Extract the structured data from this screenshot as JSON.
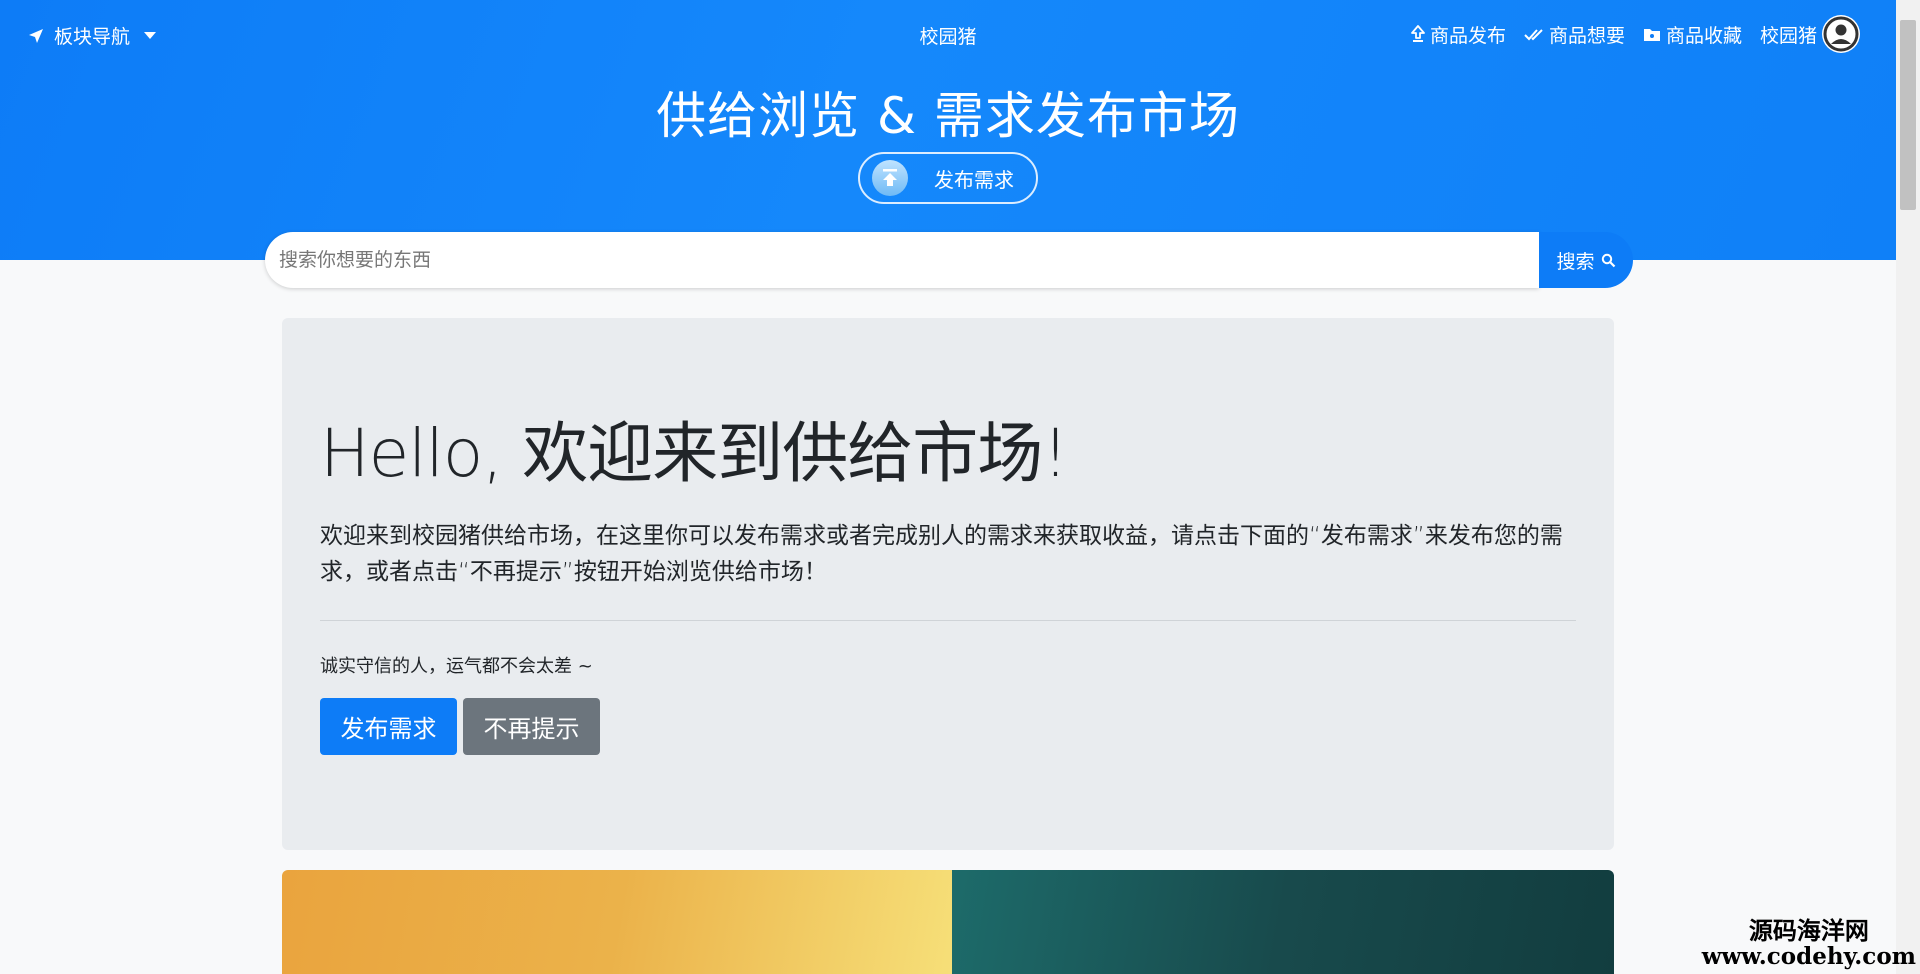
{
  "nav": {
    "section_nav_label": "板块导航",
    "brand": "校园猪",
    "items": [
      {
        "label": "商品发布",
        "icon": "upload-icon"
      },
      {
        "label": "商品想要",
        "icon": "double-check-icon"
      },
      {
        "label": "商品收藏",
        "icon": "folder-icon"
      }
    ],
    "username": "校园猪"
  },
  "hero": {
    "title": "供给浏览 & 需求发布市场",
    "publish_label": "发布需求"
  },
  "search": {
    "placeholder": "搜索你想要的东西",
    "button_label": "搜索"
  },
  "jumbotron": {
    "title": "Hello, 欢迎来到供给市场!",
    "lead": "欢迎来到校园猪供给市场，在这里你可以发布需求或者完成别人的需求来获取收益，请点击下面的“发布需求”来发布您的需求，或者点击“不再提示”按钮开始浏览供给市场！",
    "note": "诚实守信的人，运气都不会太差 ~",
    "primary_button": "发布需求",
    "secondary_button": "不再提示"
  },
  "watermark": {
    "line1": "源码海洋网",
    "line2": "www.codehy.com"
  },
  "colors": {
    "accent": "#0d7cf7",
    "secondary": "#6c757d",
    "panel": "#e9ecef"
  }
}
